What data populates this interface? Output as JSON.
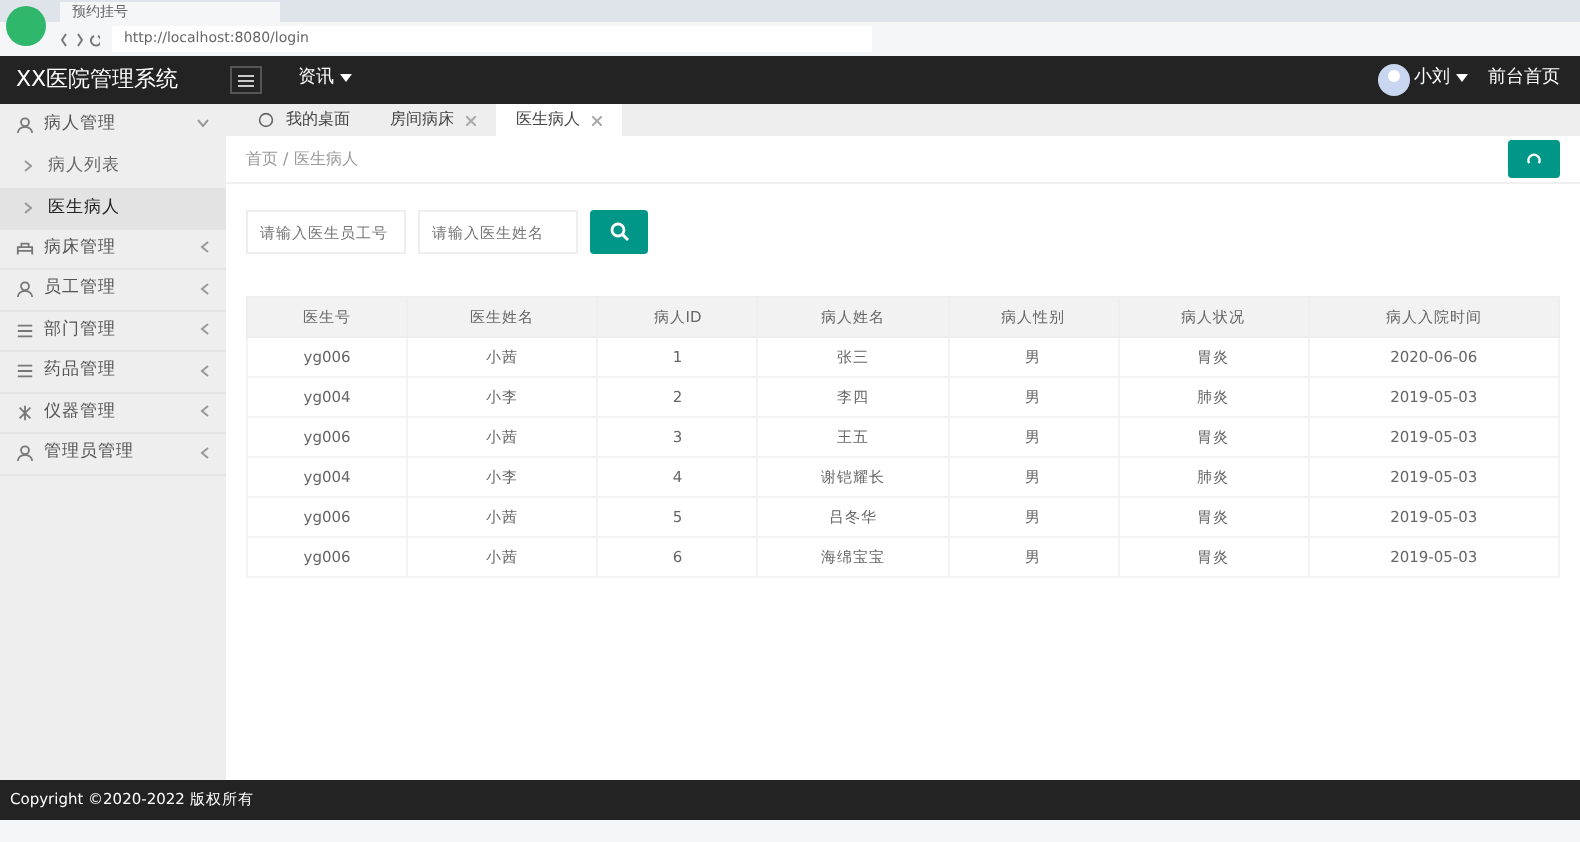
{
  "browser": {
    "tab_title": "预约挂号",
    "url": "http://localhost:8080/login"
  },
  "navbar": {
    "brand": "XX医院管理系统",
    "menu": "资讯",
    "user": "小刘",
    "home_link": "前台首页"
  },
  "sidebar": {
    "items": [
      {
        "label": "病人管理",
        "expanded": true,
        "children": [
          {
            "label": "病人列表",
            "selected": false
          },
          {
            "label": "医生病人",
            "selected": true
          }
        ]
      },
      {
        "label": "病床管理",
        "expanded": false
      },
      {
        "label": "员工管理",
        "expanded": false
      },
      {
        "label": "部门管理",
        "expanded": false
      },
      {
        "label": "药品管理",
        "expanded": false
      },
      {
        "label": "仪器管理",
        "expanded": false
      },
      {
        "label": "管理员管理",
        "expanded": false
      }
    ]
  },
  "tabs": [
    {
      "label": "我的桌面",
      "kind": "home",
      "selected": false
    },
    {
      "label": "房间病床",
      "kind": "closable",
      "selected": false
    },
    {
      "label": "医生病人",
      "kind": "closable",
      "selected": true
    }
  ],
  "breadcrumb": "首页 / 医生病人",
  "search": {
    "fields": [
      {
        "placeholder": "请输入医生员工号"
      },
      {
        "placeholder": "请输入医生姓名"
      }
    ]
  },
  "table": {
    "columns": [
      "医生号",
      "医生姓名",
      "病人ID",
      "病人姓名",
      "病人性别",
      "病人状况",
      "病人入院时间"
    ],
    "rows": [
      [
        "yg006",
        "小茜",
        "1",
        "张三",
        "男",
        "胃炎",
        "2020-06-06"
      ],
      [
        "yg004",
        "小李",
        "2",
        "李四",
        "男",
        "肺炎",
        "2019-05-03"
      ],
      [
        "yg006",
        "小茜",
        "3",
        "王五",
        "男",
        "胃炎",
        "2019-05-03"
      ],
      [
        "yg004",
        "小李",
        "4",
        "谢铠耀长",
        "男",
        "肺炎",
        "2019-05-03"
      ],
      [
        "yg006",
        "小茜",
        "5",
        "吕冬华",
        "男",
        "胃炎",
        "2019-05-03"
      ],
      [
        "yg006",
        "小茜",
        "6",
        "海绵宝宝",
        "男",
        "胃炎",
        "2019-05-03"
      ]
    ]
  },
  "footer": "Copyright ©2020-2022 版权所有"
}
